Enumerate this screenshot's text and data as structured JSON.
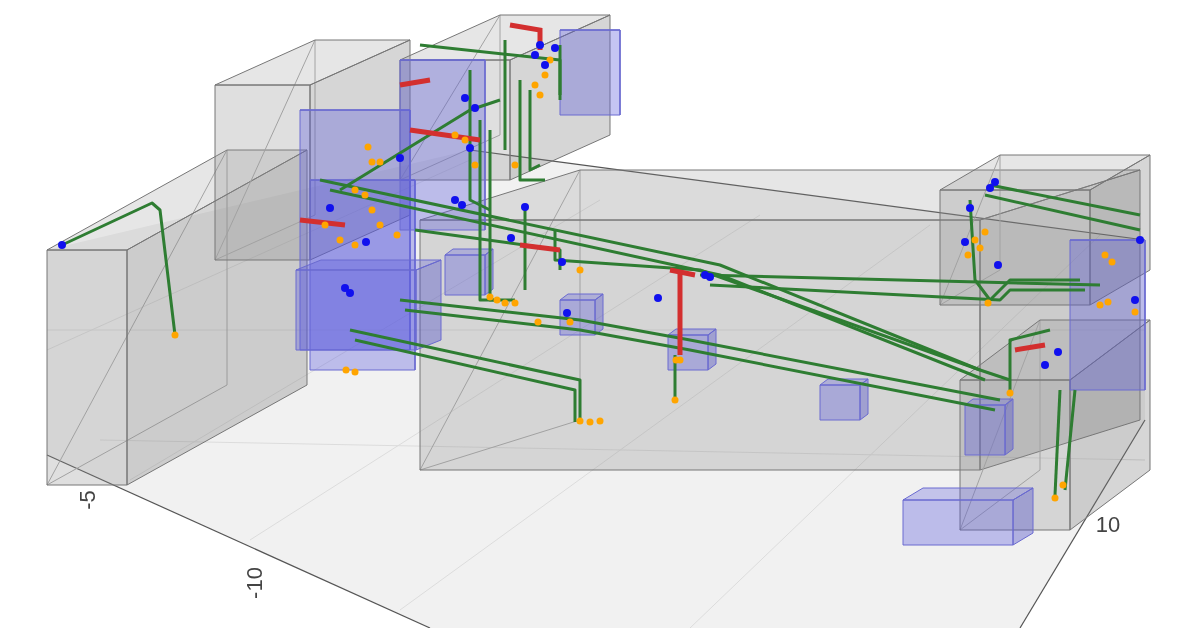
{
  "axis_ticks": [
    {
      "label": "-5"
    },
    {
      "label": "-10"
    },
    {
      "label": "10"
    }
  ]
}
